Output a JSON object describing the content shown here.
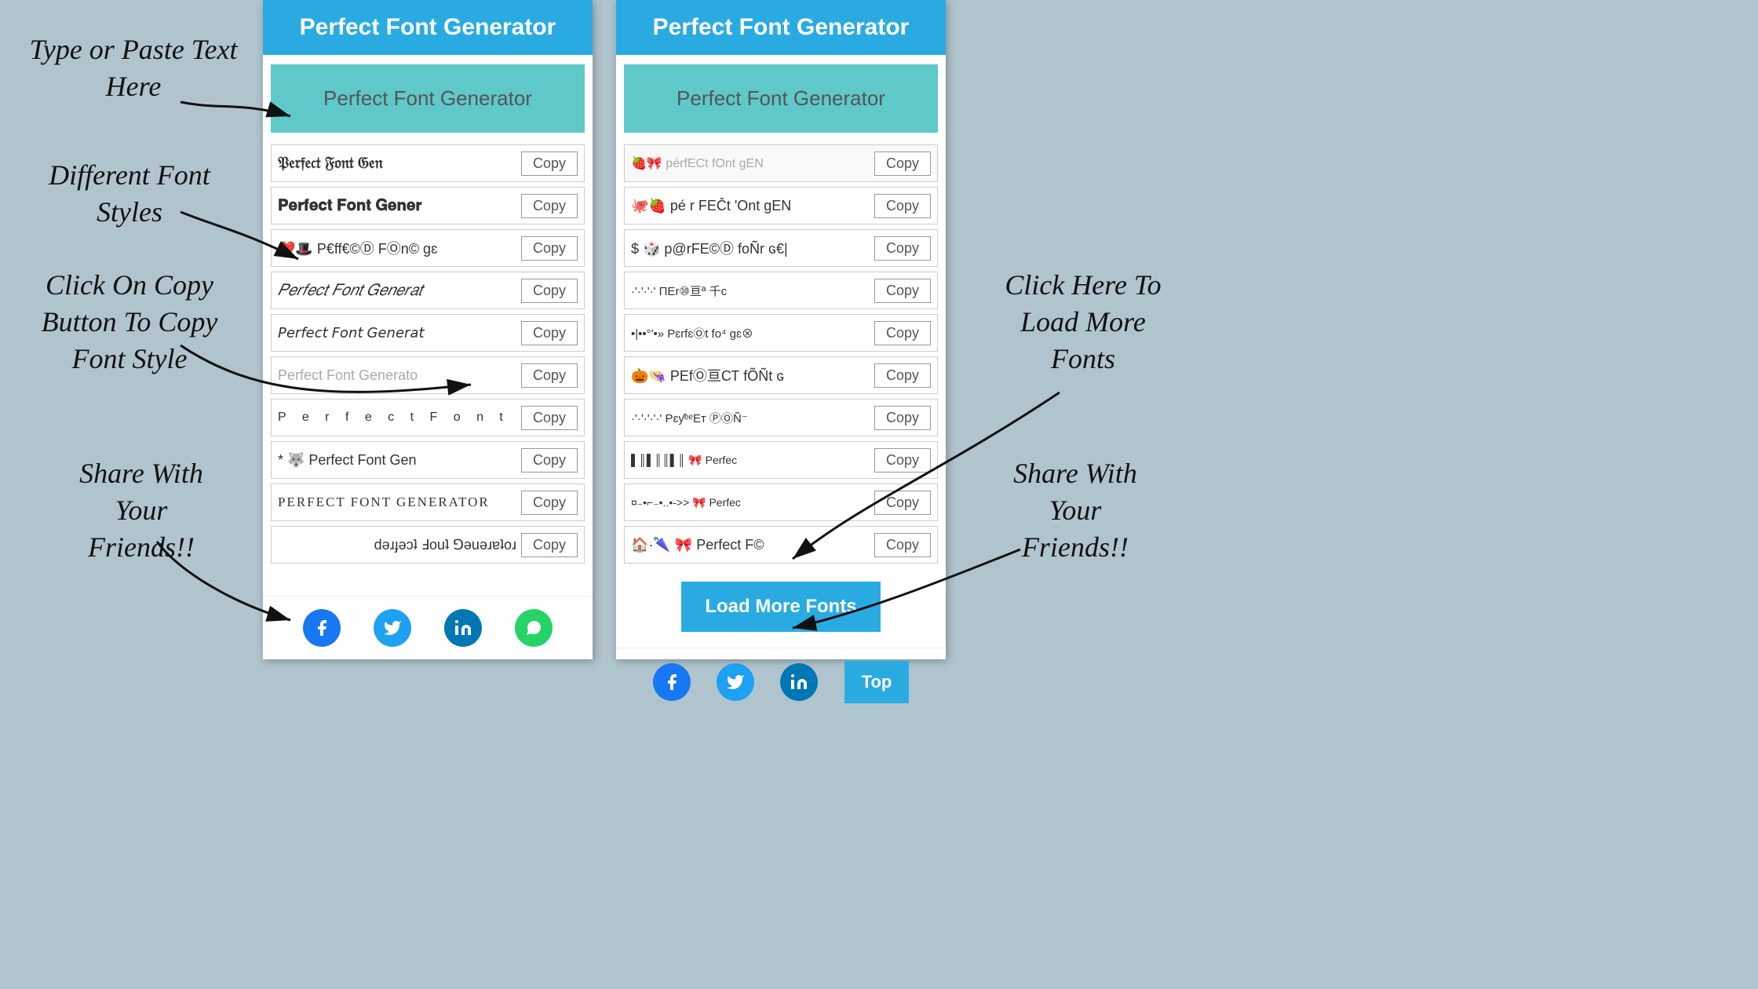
{
  "app": {
    "title": "Perfect Font Generator",
    "input_placeholder": "Perfect Font Generator",
    "header_left": "Perfect Font Generator",
    "header_right": "Perfect Font Generator"
  },
  "annotations": {
    "type_paste": "Type or Paste Text\nHere",
    "different_fonts": "Different Font\nStyles",
    "click_copy": "Click On Copy\nButton To Copy\nFont Style",
    "share": "Share With\nYour\nFriends!!",
    "load_more": "Click Here To\nLoad More\nFonts",
    "share_right": "Share With\nYour\nFriends!!"
  },
  "left_panel": {
    "header": "Perfect Font Generator",
    "input_value": "Perfect Font Generator",
    "font_rows": [
      {
        "text": "𝔓𝔢𝔯𝔣𝔢𝔠𝔱 𝔉𝔬𝔫𝔱 𝔊𝔢𝔫𝔢𝔯𝔞𝔱𝔬𝔯",
        "style": "gothic",
        "copy": "Copy"
      },
      {
        "text": "𝐏𝐞𝐫𝐟𝐞𝐜𝐭 𝐅𝐨𝐧𝐭 𝐆𝐞𝐧𝐞𝐫𝐚𝐭𝐨𝐫",
        "style": "bold",
        "copy": "Copy"
      },
      {
        "text": "❤️🎩 P€ff€©Ⓓ FⓄn© gɛ",
        "style": "emoji",
        "copy": "Copy"
      },
      {
        "text": "𝑃𝑒𝑟𝑓𝑒𝑐𝑡 𝐹𝑜𝑛𝑡 𝐺𝑒𝑛𝑒𝑟𝑎𝑡",
        "style": "italic",
        "copy": "Copy"
      },
      {
        "text": "𝘗𝘦𝘳𝘧𝘦𝘤𝘵 𝘍𝘰𝘯𝘵 𝘎𝘦𝘯𝘦𝘳𝘢𝘵𝘰",
        "style": "italic2",
        "copy": "Copy"
      },
      {
        "text": "Perfect Font Generator",
        "style": "outline",
        "copy": "Copy"
      },
      {
        "text": "P e r f e c t  F o n t",
        "style": "spaced",
        "copy": "Copy"
      },
      {
        "text": "* 🐺 Perfect Font Gen",
        "style": "emoji2",
        "copy": "Copy"
      },
      {
        "text": "PERFECT FONT GENERATOR",
        "style": "caps",
        "copy": "Copy"
      },
      {
        "text": "ɹoʇɐɹǝuǝ⅁ ʇuoℲ ʇɔǝɟɹǝd",
        "style": "reverse",
        "copy": "Copy"
      }
    ],
    "social": [
      {
        "icon": "f",
        "name": "facebook",
        "label": "Facebook"
      },
      {
        "icon": "🐦",
        "name": "twitter",
        "label": "Twitter"
      },
      {
        "icon": "in",
        "name": "linkedin",
        "label": "LinkedIn"
      },
      {
        "icon": "✆",
        "name": "whatsapp",
        "label": "WhatsApp"
      }
    ]
  },
  "right_panel": {
    "header": "Perfect Font Generator",
    "input_value": "Perfect Font Generator",
    "font_rows": [
      {
        "text": "🐙🍓 pé r FEČt 'Ont gEN",
        "style": "emoji",
        "copy": "Copy"
      },
      {
        "text": "$ 🎲 p@rFE©Ⓓ foÑr ɢ€|",
        "style": "emoji2",
        "copy": "Copy"
      },
      {
        "text": "·'·'·'·' ΠEr⑩亘ª 千c",
        "style": "small",
        "copy": "Copy"
      },
      {
        "text": "•|••°'•»  PɛrfɛⓄt fo⁴ gɛ⊗",
        "style": "small2",
        "copy": "Copy"
      },
      {
        "text": "🎃👒 PΕfⓄ亘СТ fÕÑt ɢ",
        "style": "emoji3",
        "copy": "Copy"
      },
      {
        "text": "·'·'·'·'·' PɛƴᵉᵉΕт ⓅⓄÑ⁻",
        "style": "small3",
        "copy": "Copy"
      },
      {
        "text": "▌║▌║║▌║ 🎀 Perfec",
        "style": "barcode",
        "copy": "Copy"
      },
      {
        "text": "¤₋•⌐₋•..•->> 🎀 Perfec",
        "style": "small4",
        "copy": "Copy"
      },
      {
        "text": "🏠·🌂 🎀 Perfect F©",
        "style": "emoji4",
        "copy": "Copy"
      }
    ],
    "load_more": "Load More Fonts",
    "top": "Top",
    "social": [
      {
        "icon": "f",
        "name": "facebook",
        "label": "Facebook"
      },
      {
        "icon": "🐦",
        "name": "twitter",
        "label": "Twitter"
      },
      {
        "icon": "in",
        "name": "linkedin",
        "label": "LinkedIn"
      }
    ]
  }
}
